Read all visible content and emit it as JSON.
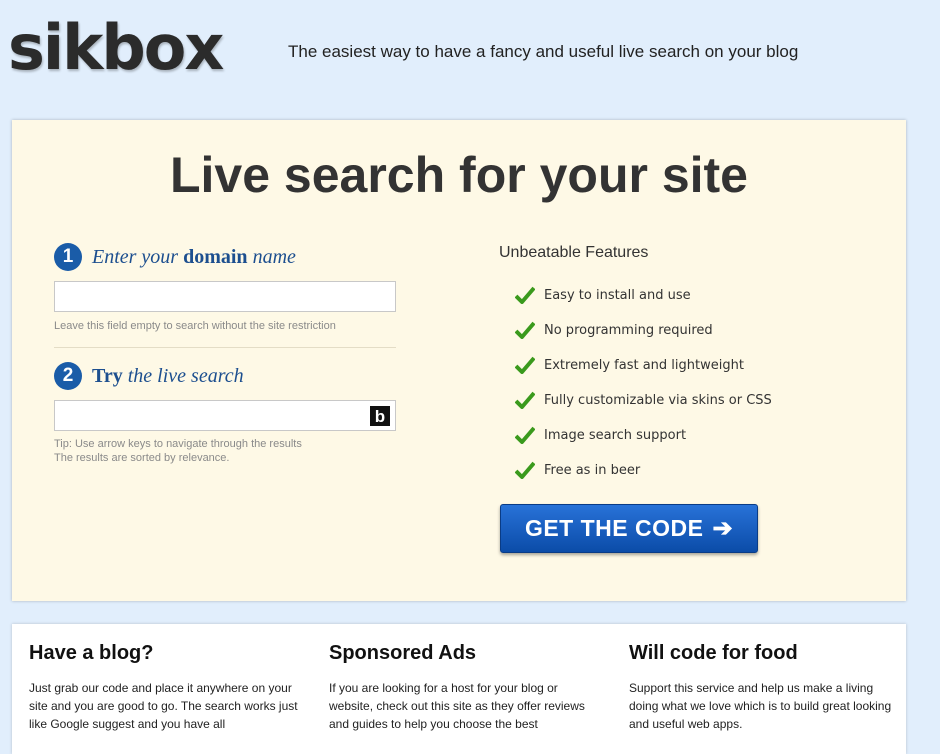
{
  "header": {
    "logo": "sikbox",
    "tagline": "The easiest way to have a fancy and useful live search on your blog"
  },
  "hero": {
    "title": "Live search for your site",
    "step1": {
      "number": "1",
      "text_a": "Enter your ",
      "text_b": "domain",
      "text_c": " name",
      "input_value": "",
      "hint": "Leave this field empty to search without the site restriction"
    },
    "step2": {
      "number": "2",
      "text_a": "Try",
      "text_b": " the live search",
      "input_value": "",
      "search_icon": "b",
      "hint_line1": "Tip: Use arrow keys to navigate through the results",
      "hint_line2": "The results are sorted by relevance."
    },
    "features": {
      "title": "Unbeatable Features",
      "items": [
        "Easy to install and use",
        "No programming required",
        "Extremely fast and lightweight",
        "Fully customizable via skins or CSS",
        "Image search support",
        "Free as in beer"
      ]
    },
    "cta": {
      "label": "GET THE CODE",
      "arrow": "➔"
    }
  },
  "colors": {
    "background": "#e1eefc",
    "hero_bg": "#fef9e6",
    "accent_blue": "#1a5ca8",
    "check_green": "#3a9a1c"
  },
  "columns": [
    {
      "title": "Have a blog?",
      "text": "Just grab our code and place it anywhere on your site and you are good to go. The search works just like Google suggest and you have all"
    },
    {
      "title": "Sponsored Ads",
      "text": "If you are looking for a host for your blog or website, check out this site as they offer reviews and guides to help you choose the best"
    },
    {
      "title": "Will code for food",
      "text": "Support this service and help us make a living doing what we love which is to build great looking and useful web apps."
    }
  ]
}
